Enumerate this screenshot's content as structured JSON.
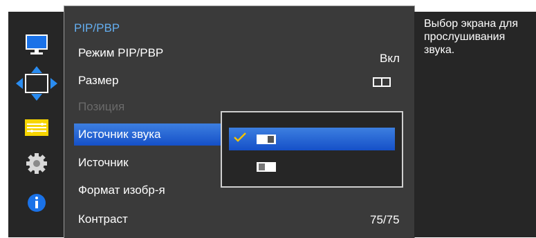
{
  "menu": {
    "title": "PIP/PBP",
    "items": [
      {
        "label": "Режим PIP/PBP",
        "value": "Вкл",
        "state": "normal"
      },
      {
        "label": "Размер",
        "value_icon": "pbp-split-icon",
        "state": "normal"
      },
      {
        "label": "Позиция",
        "state": "disabled"
      },
      {
        "label": "Источник звука",
        "state": "selected"
      },
      {
        "label": "Источник",
        "state": "normal"
      },
      {
        "label": "Формат изобр-я",
        "state": "normal"
      },
      {
        "label": "Контраст",
        "value": "75/75",
        "state": "normal"
      }
    ]
  },
  "sidebar": {
    "icons": [
      "picture-monitor-icon",
      "screen-adjust-arrows-icon",
      "pip-pbp-menu-icon",
      "settings-gear-icon",
      "information-icon"
    ],
    "active_index": 1
  },
  "popup": {
    "options": [
      {
        "icon": "main-screen-audio-icon",
        "checked": true
      },
      {
        "icon": "sub-screen-audio-icon",
        "checked": false
      }
    ]
  },
  "help": {
    "text": "Выбор экрана для прослушивания звука."
  },
  "colors": {
    "accent": "#2a6de0",
    "title": "#64aef0",
    "check": "#f5c400",
    "panel": "#3a3a3a",
    "dark": "#262626"
  }
}
